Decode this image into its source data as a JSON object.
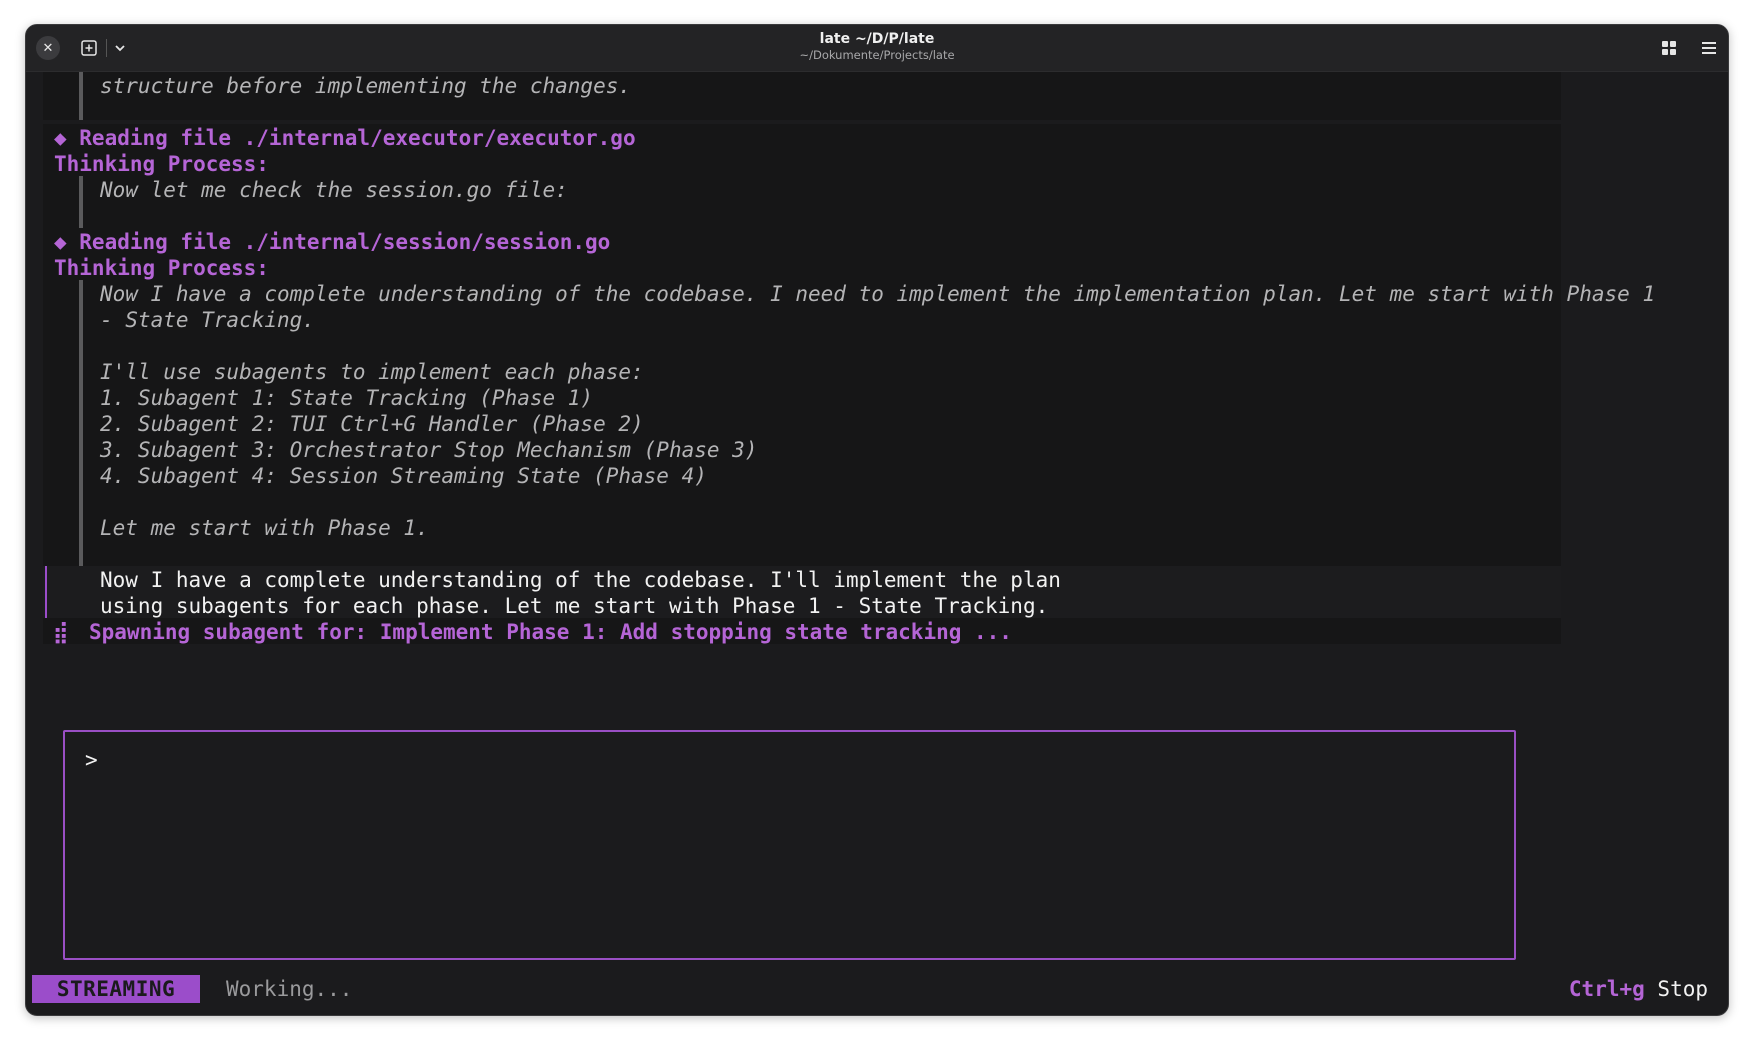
{
  "window": {
    "title": "late ~/D/P/late",
    "subtitle": "~/Dokumente/Projects/late"
  },
  "icons": {
    "close": "close-icon",
    "new_tab": "new-tab-icon",
    "chevron": "chevron-down-icon",
    "grid": "grid-icon",
    "menu": "hamburger-menu-icon",
    "diamond": "diamond-icon",
    "spinner": "braille-spinner-icon"
  },
  "transcript": {
    "thinking_1_tail": "structure before implementing the changes.",
    "tool_1": "◆ Reading file ./internal/executor/executor.go",
    "thinking_2_header": "Thinking Process:",
    "thinking_2_line": "Now let me check the session.go file:",
    "tool_2": "◆ Reading file ./internal/session/session.go",
    "thinking_3_header": "Thinking Process:",
    "thinking_3_lines": [
      "Now I have a complete understanding of the codebase. I need to implement the implementation plan. Let me start with Phase 1",
      "- State Tracking.",
      "",
      "I'll use subagents to implement each phase:",
      "1. Subagent 1: State Tracking (Phase 1)",
      "2. Subagent 2: TUI Ctrl+G Handler (Phase 2)",
      "3. Subagent 3: Orchestrator Stop Mechanism (Phase 3)",
      "4. Subagent 4: Session Streaming State (Phase 4)",
      "",
      "Let me start with Phase 1."
    ],
    "assistant_lines": [
      "Now I have a complete understanding of the codebase. I'll implement the plan",
      "using subagents for each phase. Let me start with Phase 1 - State Tracking."
    ],
    "spinner_glyph": "⣾",
    "spawning": "Spawning subagent for: Implement Phase 1: Add stopping state tracking ..."
  },
  "input": {
    "prompt": ">",
    "value": ""
  },
  "status": {
    "mode": "STREAMING",
    "activity": "Working...",
    "hint_key": "Ctrl+g",
    "hint_action": "Stop"
  },
  "colors": {
    "accent": "#9b4dca",
    "background": "#1b1b1d"
  }
}
